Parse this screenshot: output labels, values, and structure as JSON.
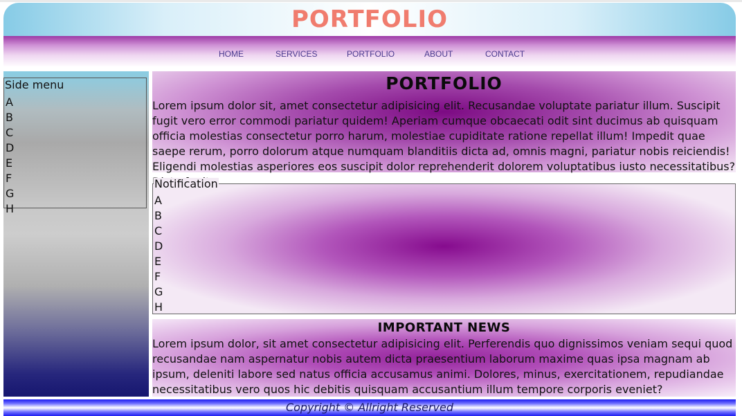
{
  "header": {
    "title": "PORTFOLIO",
    "nav": [
      {
        "label": "HOME"
      },
      {
        "label": "SERVICES"
      },
      {
        "label": "PORTFOLIO"
      },
      {
        "label": "ABOUT"
      },
      {
        "label": "CONTACT"
      }
    ]
  },
  "sidebar": {
    "legend": "Side menu",
    "items": [
      "A",
      "B",
      "C",
      "D",
      "E",
      "F",
      "G",
      "H"
    ]
  },
  "main": {
    "title": "PORTFOLIO",
    "text": "Lorem ipsum dolor sit, amet consectetur adipisicing elit. Recusandae voluptate pariatur illum. Suscipit fugit vero error commodi pariatur quidem! Aperiam cumque obcaecati odit sint ducimus ab quisquam officia molestias consectetur porro harum, molestiae cupiditate ratione repellat illum! Impedit quae saepe rerum, porro dolorum atque numquam blanditiis dicta ad, omnis magni, pariatur nobis reiciendis! Eligendi molestias asperiores eos suscipit dolor reprehenderit dolorem voluptatibus iusto necessitatibus? Dicta fugit."
  },
  "notification": {
    "legend": "Notification",
    "items": [
      "A",
      "B",
      "C",
      "D",
      "E",
      "F",
      "G",
      "H"
    ]
  },
  "news": {
    "title": "IMPORTANT NEWS",
    "text": "Lorem ipsum dolor, sit amet consectetur adipisicing elit. Perferendis quo dignissimos veniam sequi quod recusandae nam aspernatur nobis autem dicta praesentium laborum maxime quas ipsa magnam ab ipsum, deleniti labore sed natus officia accusamus animi. Dolores, minus, exercitationem, repudiandae necessitatibus vero quos hic debitis quisquam accusantium illum tempore corporis eveniet?"
  },
  "footer": {
    "text": "Copyright © Allright Reserved"
  },
  "colors": {
    "title": "#f07c6e",
    "nav_text": "#4b3b8f",
    "accent_purple": "#860b8e",
    "sky_blue": "#86cbe6",
    "footer_blue": "#1c1cf0"
  }
}
